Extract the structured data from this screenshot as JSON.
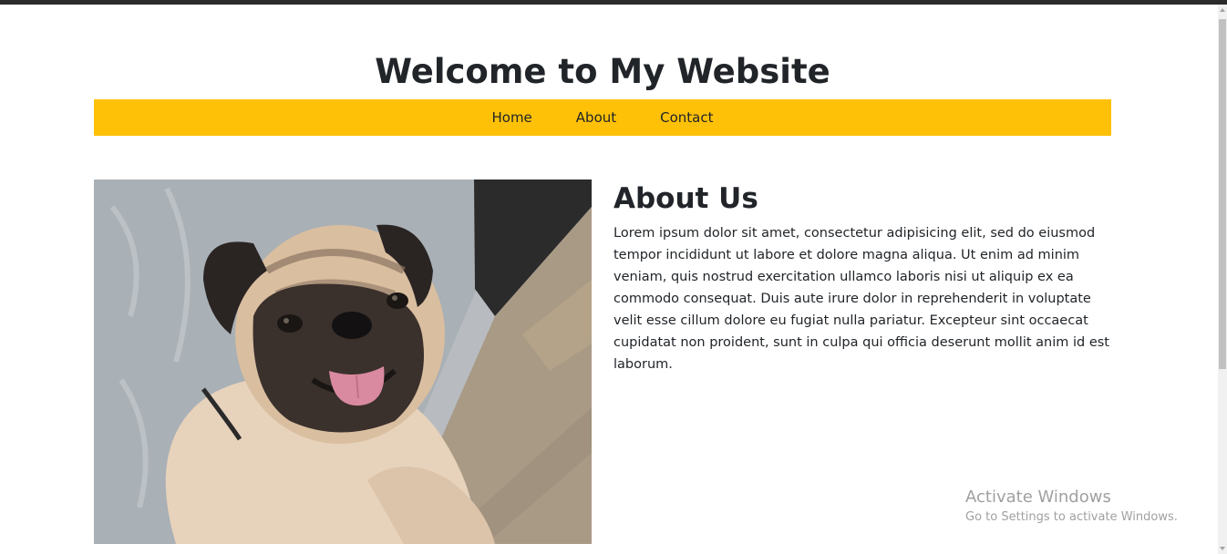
{
  "header": {
    "title": "Welcome to My Website"
  },
  "nav": {
    "items": [
      {
        "label": "Home"
      },
      {
        "label": "About"
      },
      {
        "label": "Contact"
      }
    ]
  },
  "about": {
    "heading": "About Us",
    "body": "Lorem ipsum dolor sit amet, consectetur adipisicing elit, sed do eiusmod tempor incididunt ut labore et dolore magna aliqua. Ut enim ad minim veniam, quis nostrud exercitation ullamco laboris nisi ut aliquip ex ea commodo consequat. Duis aute irure dolor in reprehenderit in voluptate velit esse cillum dolore eu fugiat nulla pariatur. Excepteur sint occaecat cupidatat non proident, sunt in culpa qui officia deserunt mollit anim id est laborum."
  },
  "image": {
    "subject": "pug-photo"
  },
  "os_watermark": {
    "title": "Activate Windows",
    "subtitle": "Go to Settings to activate Windows."
  },
  "colors": {
    "nav_background": "#ffc107",
    "text": "#212529",
    "background": "#ffffff"
  }
}
